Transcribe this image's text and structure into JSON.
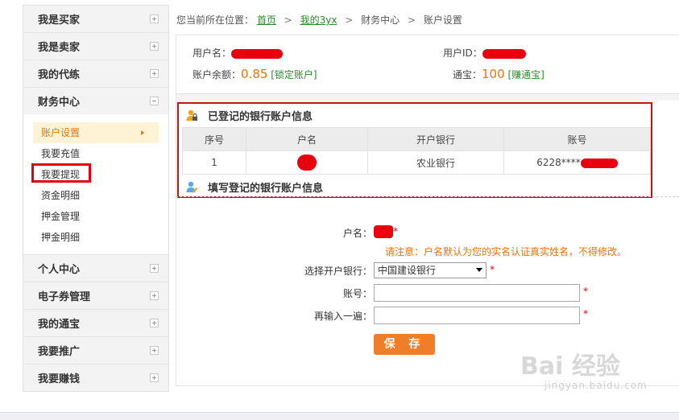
{
  "sidebar": {
    "groups": [
      {
        "label": "我是买家"
      },
      {
        "label": "我是卖家"
      },
      {
        "label": "我的代练"
      },
      {
        "label": "财务中心"
      },
      {
        "label": "个人中心"
      },
      {
        "label": "电子券管理"
      },
      {
        "label": "我的通宝"
      },
      {
        "label": "我要推广"
      },
      {
        "label": "我要赚钱"
      }
    ],
    "finance_items": [
      "账户设置",
      "我要充值",
      "我要提现",
      "资金明细",
      "押金管理",
      "押金明细"
    ]
  },
  "breadcrumb": {
    "prefix": "您当前所在位置：",
    "home": "首页",
    "my": "我的3yx",
    "finance": "财务中心",
    "current": "账户设置",
    "sep": ">"
  },
  "account": {
    "username_label": "用户名：",
    "userid_label": "用户ID：",
    "balance_label": "账户余额：",
    "balance_value": "0.85",
    "lock_link": "[锁定账户]",
    "tongbao_label": "通宝：",
    "tongbao_value": "100",
    "earn_link": "[赚通宝]"
  },
  "registered": {
    "title": "已登记的银行账户信息",
    "columns": [
      "序号",
      "户名",
      "开户银行",
      "账号"
    ],
    "row": {
      "index": "1",
      "bank": "农业银行",
      "account_prefix": "6228****"
    }
  },
  "fill": {
    "title": "填写登记的银行账户信息",
    "name_label": "户名：",
    "star": "*",
    "notice": "请注意：户名默认为您的实名认证真实姓名，不得修改。",
    "bank_label": "选择开户银行：",
    "bank_selected": "中国建设银行",
    "account_label": "账号：",
    "reenter_label": "再输入一遍：",
    "save_label": "保 存"
  },
  "watermark": {
    "text": "Bai 经验",
    "url": "jingyan.baidu.com"
  },
  "colors": {
    "accent": "#e8740c",
    "link": "#2a8a2a",
    "highlight": "#cc1111"
  }
}
